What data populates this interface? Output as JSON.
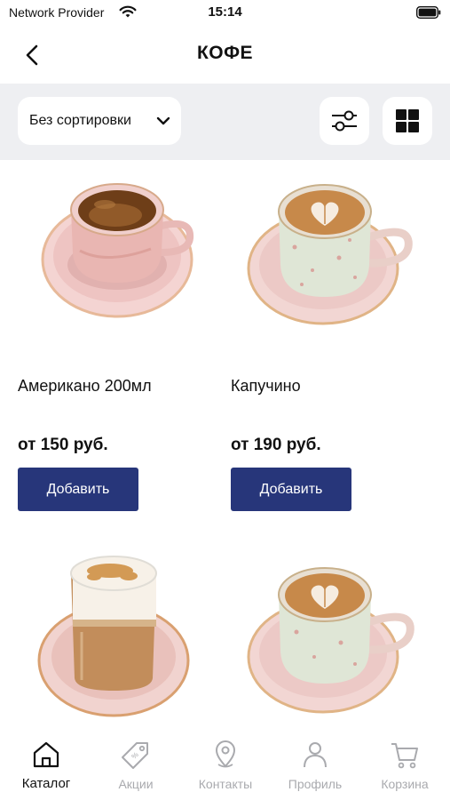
{
  "status_bar": {
    "carrier": "Network Provider",
    "time": "15:14"
  },
  "header": {
    "title": "КОФЕ",
    "back_icon": "chevron-left-icon"
  },
  "toolbar": {
    "sort_label": "Без сортировки",
    "sort_icon": "chevron-down-icon",
    "filter_icon": "sliders-icon",
    "grid_icon": "grid-icon"
  },
  "products": [
    {
      "name": "Американо 200мл",
      "price": "от 150 руб.",
      "button": "Добавить",
      "image": "americano-cup"
    },
    {
      "name": "Капучино",
      "price": "от 190 руб.",
      "button": "Добавить",
      "image": "cappuccino-cup"
    },
    {
      "image": "latte-glass"
    },
    {
      "image": "cappuccino-cup"
    }
  ],
  "tab_bar": {
    "items": [
      {
        "label": "Каталог",
        "icon": "home-icon",
        "active": true
      },
      {
        "label": "Акции",
        "icon": "tag-icon",
        "active": false
      },
      {
        "label": "Контакты",
        "icon": "map-pin-icon",
        "active": false
      },
      {
        "label": "Профиль",
        "icon": "user-icon",
        "active": false
      },
      {
        "label": "Корзина",
        "icon": "cart-icon",
        "active": false
      }
    ]
  },
  "colors": {
    "accent": "#27367a",
    "toolbar_bg": "#eeeff2",
    "inactive_tab": "#a9aaae"
  }
}
